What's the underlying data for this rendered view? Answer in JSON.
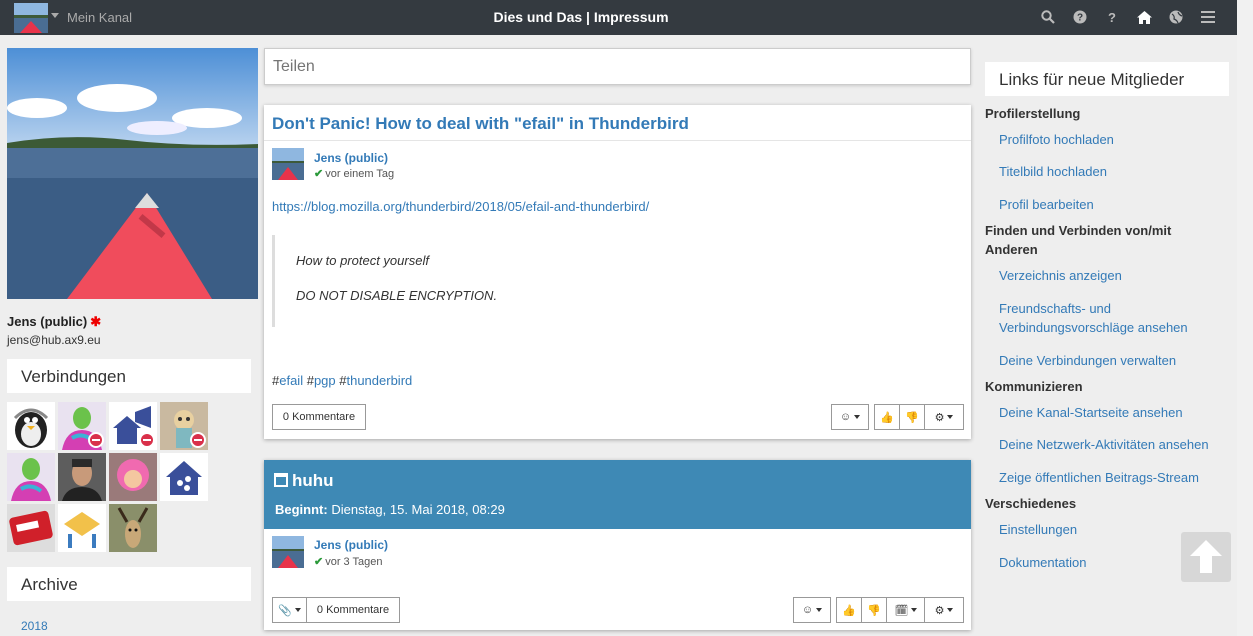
{
  "navbar": {
    "channel_label": "Mein Kanal",
    "title": "Dies und Das | Impressum",
    "icons": [
      "search-icon",
      "help-circle-icon",
      "question-icon",
      "home-icon",
      "globe-icon",
      "menu-icon"
    ],
    "icon_glyphs": {
      "question": "?"
    }
  },
  "profile": {
    "name": "Jens (public)",
    "star": "✱",
    "address": "jens@hub.ax9.eu"
  },
  "connections": {
    "title": "Verbindungen"
  },
  "archive": {
    "title": "Archive",
    "years": [
      "2018"
    ]
  },
  "share": {
    "placeholder": "Teilen"
  },
  "post1": {
    "title": "Don't Panic! How to deal with \"efail\" in Thunderbird",
    "author": "Jens (public)",
    "time": "vor einem Tag",
    "link": "https://blog.mozilla.org/thunderbird/2018/05/efail-and-thunderbird/",
    "quote_line1": "How to protect yourself",
    "quote_line2": "DO NOT DISABLE ENCRYPTION.",
    "tags": [
      "efail",
      "pgp",
      "thunderbird"
    ],
    "comments_label": "0 Kommentare"
  },
  "event": {
    "title": "huhu",
    "begin_label": "Beginnt:",
    "begin_value": "Dienstag, 15. Mai 2018, 08:29",
    "author": "Jens (public)",
    "time": "vor 3 Tagen",
    "comments_label": "0 Kommentare"
  },
  "links": {
    "title": "Links für neue Mitglieder",
    "sections": [
      {
        "label": "Profilerstellung",
        "items": [
          "Profilfoto hochladen",
          "Titelbild hochladen",
          "Profil bearbeiten"
        ]
      },
      {
        "label": "Finden und Verbinden von/mit Anderen",
        "items": [
          "Verzeichnis anzeigen",
          "Freundschafts- und Verbindungsvorschläge ansehen",
          "Deine Verbindungen verwalten"
        ]
      },
      {
        "label": "Kommunizieren",
        "items": [
          "Deine Kanal-Startseite ansehen",
          "Deine Netzwerk-Aktivitäten ansehen",
          "Zeige öffentlichen Beitrags-Stream"
        ]
      },
      {
        "label": "Verschiedenes",
        "items": [
          "Einstellungen",
          "Dokumentation"
        ]
      }
    ]
  },
  "colors": {
    "navbar": "#343a40",
    "accent": "#337ab7",
    "event_header": "#3e89b5",
    "verified": "#2b9a3a",
    "remove_badge": "#d9304a"
  }
}
